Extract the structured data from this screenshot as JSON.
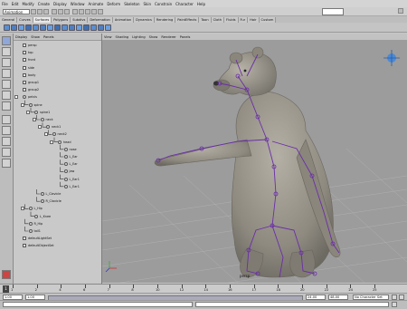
{
  "menubar": {
    "items": [
      "File",
      "Edit",
      "Modify",
      "Create",
      "Display",
      "Window",
      "Animate",
      "Deform",
      "Skeleton",
      "Skin",
      "Constrain",
      "Character",
      "Help"
    ]
  },
  "statusline": {
    "mode": "Animation"
  },
  "shelf_tabs": {
    "items": [
      "General",
      "Curves",
      "Surfaces",
      "Polygons",
      "Subdivs",
      "Deformation",
      "Animation",
      "Dynamics",
      "Rendering",
      "PaintEffects",
      "Toon",
      "Cloth",
      "Fluids",
      "Fur",
      "Hair",
      "Custom"
    ],
    "active_index": 2
  },
  "outliner": {
    "menu": [
      "Display",
      "Show",
      "Panels"
    ],
    "items": [
      {
        "label": "persp",
        "depth": 0,
        "icon": "camera"
      },
      {
        "label": "top",
        "depth": 0,
        "icon": "camera"
      },
      {
        "label": "front",
        "depth": 0,
        "icon": "camera"
      },
      {
        "label": "side",
        "depth": 0,
        "icon": "camera"
      },
      {
        "label": "body",
        "depth": 0,
        "icon": "mesh"
      },
      {
        "label": "group1",
        "depth": 0,
        "icon": "group"
      },
      {
        "label": "group2",
        "depth": 0,
        "icon": "group"
      },
      {
        "label": "pelvis",
        "depth": 0,
        "icon": "joint"
      },
      {
        "label": "spine",
        "depth": 1,
        "icon": "joint"
      },
      {
        "label": "spine1",
        "depth": 2,
        "icon": "joint"
      },
      {
        "label": "neck",
        "depth": 3,
        "icon": "joint"
      },
      {
        "label": "neck1",
        "depth": 4,
        "icon": "joint"
      },
      {
        "label": "neck2",
        "depth": 5,
        "icon": "joint"
      },
      {
        "label": "head",
        "depth": 6,
        "icon": "joint"
      },
      {
        "label": "nose",
        "depth": 7,
        "icon": "joint"
      },
      {
        "label": "L_Ear",
        "depth": 7,
        "icon": "joint"
      },
      {
        "label": "L_Ear",
        "depth": 7,
        "icon": "joint"
      },
      {
        "label": "jaw",
        "depth": 7,
        "icon": "joint"
      },
      {
        "label": "L_Ear1",
        "depth": 7,
        "icon": "joint"
      },
      {
        "label": "L_Ear1",
        "depth": 7,
        "icon": "joint"
      },
      {
        "label": "L_Clavicle",
        "depth": 3,
        "icon": "joint"
      },
      {
        "label": "R_Clavicle",
        "depth": 3,
        "icon": "joint"
      },
      {
        "label": "L_Hip",
        "depth": 1,
        "icon": "joint"
      },
      {
        "label": "L_Knee",
        "depth": 2,
        "icon": "joint"
      },
      {
        "label": "R_Hip",
        "depth": 1,
        "icon": "joint"
      },
      {
        "label": "tail1",
        "depth": 1,
        "icon": "joint"
      },
      {
        "label": "defaultLightSet",
        "depth": 0,
        "icon": "set"
      },
      {
        "label": "defaultObjectSet",
        "depth": 0,
        "icon": "set"
      }
    ]
  },
  "viewport": {
    "menu": [
      "View",
      "Shading",
      "Lighting",
      "Show",
      "Renderer",
      "Panels"
    ],
    "camera_label": "persp"
  },
  "timeline": {
    "ticks": [
      "1",
      "2",
      "4",
      "6",
      "7",
      "8",
      "10",
      "12",
      "14",
      "16",
      "17",
      "18",
      "20",
      "22",
      "24",
      "25"
    ],
    "current_frame": "1"
  },
  "range": {
    "start": "1.00",
    "inner_start": "1.00",
    "inner_end": "24.00",
    "end": "48.00",
    "character_set": "No Character Set"
  },
  "colors": {
    "viewport_bg": "#9c9c9c",
    "joint": "#6a2ea8",
    "mesh": "#8e8a80",
    "active_tab": "#e8e8e8"
  }
}
